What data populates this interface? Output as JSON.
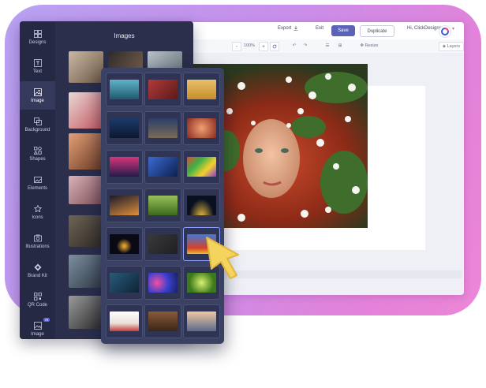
{
  "topbar": {
    "export_label": "Export",
    "exit_label": "Exit",
    "save_label": "Save",
    "duplicate_label": "Duplicate",
    "greeting": "Hi, ClickDesigns"
  },
  "toolbar": {
    "zoom": "100%",
    "zoom_minus": "-",
    "zoom_plus": "+",
    "resize_label": "Resize",
    "layers_label": "Layers"
  },
  "sidebar": {
    "items": [
      {
        "label": "Designs",
        "icon": "grid-icon"
      },
      {
        "label": "Text",
        "icon": "text-icon"
      },
      {
        "label": "Image",
        "icon": "image-icon",
        "active": true
      },
      {
        "label": "Background",
        "icon": "background-icon"
      },
      {
        "label": "Shapes",
        "icon": "shapes-icon"
      },
      {
        "label": "Elements",
        "icon": "elements-icon"
      },
      {
        "label": "Icons",
        "icon": "star-icon"
      },
      {
        "label": "Illustrations",
        "icon": "illustrations-icon"
      },
      {
        "label": "Brand Kit",
        "icon": "brand-kit-icon"
      },
      {
        "label": "QR Code",
        "icon": "qr-code-icon"
      },
      {
        "label": "Image",
        "icon": "ai-image-icon",
        "badge": "AI"
      }
    ]
  },
  "panel": {
    "title": "Images"
  },
  "colors": {
    "accent": "#5b63b7",
    "sidebar_bg": "#2b2f4c",
    "popup_bg": "#3b4163",
    "cursor": "#f4d35e"
  }
}
